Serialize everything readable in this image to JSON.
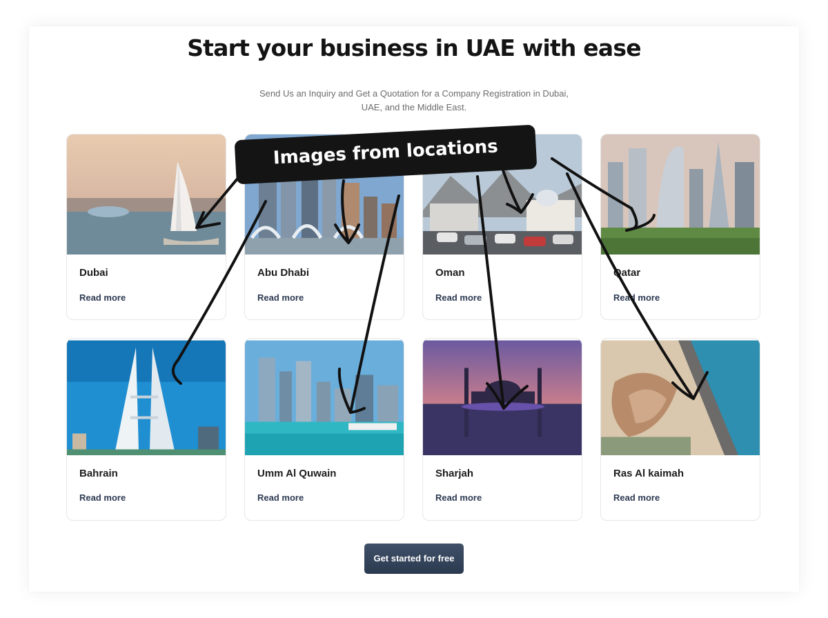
{
  "header": {
    "title": "Start your business in UAE with ease",
    "subtitle": "Send Us an Inquiry and Get a Quotation for a Company Registration in Dubai, UAE, and the Middle East."
  },
  "locations": [
    {
      "name": "Dubai",
      "link": "Read more"
    },
    {
      "name": "Abu Dhabi",
      "link": "Read more"
    },
    {
      "name": "Oman",
      "link": "Read more"
    },
    {
      "name": "Qatar",
      "link": "Read more"
    },
    {
      "name": "Bahrain",
      "link": "Read more"
    },
    {
      "name": "Umm Al Quwain",
      "link": "Read more"
    },
    {
      "name": "Sharjah",
      "link": "Read more"
    },
    {
      "name": "Ras Al kaimah",
      "link": "Read more"
    }
  ],
  "cta": {
    "label": "Get started for free"
  },
  "annotation": {
    "label": "Images from locations"
  },
  "colors": {
    "cta_bg": "#2b3a50",
    "link": "#2d3a52",
    "annotation_bg": "#141414"
  }
}
